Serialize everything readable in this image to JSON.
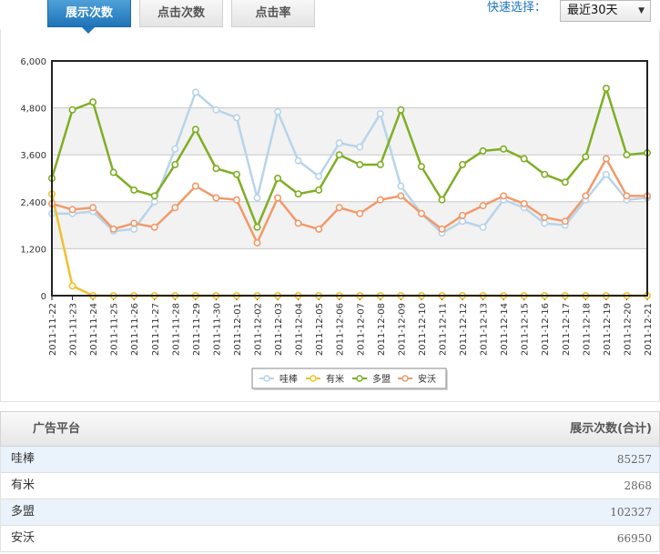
{
  "tabs": [
    {
      "label": "展示次数",
      "active": true
    },
    {
      "label": "点击次数",
      "active": false
    },
    {
      "label": "点击率",
      "active": false
    }
  ],
  "quick_select": {
    "label": "快速选择：",
    "value": "最近30天"
  },
  "chart_data": {
    "type": "line",
    "ylim": [
      0,
      6000
    ],
    "y_ticks": [
      "0",
      "1,200",
      "2,400",
      "3,600",
      "4,800",
      "6,000"
    ],
    "y_tick_values": [
      0,
      1200,
      2400,
      3600,
      4800,
      6000
    ],
    "categories": [
      "2011-11-22",
      "2011-11-23",
      "2011-11-24",
      "2011-11-25",
      "2011-11-26",
      "2011-11-27",
      "2011-11-28",
      "2011-11-29",
      "2011-11-30",
      "2011-12-01",
      "2011-12-02",
      "2011-12-03",
      "2011-12-04",
      "2011-12-05",
      "2011-12-06",
      "2011-12-07",
      "2011-12-08",
      "2011-12-09",
      "2011-12-10",
      "2011-12-11",
      "2011-12-12",
      "2011-12-13",
      "2011-12-14",
      "2011-12-15",
      "2011-12-16",
      "2011-12-17",
      "2011-12-18",
      "2011-12-19",
      "2011-12-20",
      "2011-12-21"
    ],
    "grid": true,
    "legend_position": "bottom-center",
    "series": [
      {
        "name": "哇棒",
        "color": "#b8d4ea",
        "values": [
          2100,
          2100,
          2150,
          1650,
          1700,
          2400,
          3750,
          5200,
          4750,
          4550,
          2500,
          4700,
          3450,
          3050,
          3900,
          3800,
          4650,
          2800,
          2100,
          1600,
          1900,
          1750,
          2450,
          2250,
          1850,
          1800,
          2450,
          3100,
          2450,
          2500
        ]
      },
      {
        "name": "有米",
        "color": "#f2c02d",
        "values": [
          2600,
          250,
          0,
          0,
          0,
          0,
          0,
          0,
          0,
          0,
          0,
          0,
          0,
          0,
          0,
          0,
          0,
          0,
          0,
          0,
          0,
          0,
          0,
          0,
          0,
          0,
          0,
          0,
          0,
          0
        ]
      },
      {
        "name": "多盟",
        "color": "#7fae24",
        "values": [
          3000,
          4750,
          4950,
          3150,
          2700,
          2550,
          3350,
          4250,
          3250,
          3100,
          1750,
          3000,
          2600,
          2700,
          3600,
          3350,
          3350,
          4750,
          3300,
          2450,
          3350,
          3700,
          3750,
          3500,
          3100,
          2900,
          3550,
          5300,
          3600,
          3650
        ]
      },
      {
        "name": "安沃",
        "color": "#f19a6a",
        "values": [
          2350,
          2200,
          2250,
          1700,
          1850,
          1750,
          2250,
          2800,
          2500,
          2450,
          1350,
          2500,
          1850,
          1700,
          2250,
          2100,
          2450,
          2550,
          2100,
          1700,
          2050,
          2300,
          2550,
          2350,
          2000,
          1900,
          2550,
          3500,
          2550,
          2550
        ]
      }
    ]
  },
  "table": {
    "headers": [
      "广告平台",
      "展示次数(合计)"
    ],
    "rows": [
      {
        "name": "哇棒",
        "value": "85257"
      },
      {
        "name": "有米",
        "value": "2868"
      },
      {
        "name": "多盟",
        "value": "102327"
      },
      {
        "name": "安沃",
        "value": "66950"
      }
    ]
  }
}
